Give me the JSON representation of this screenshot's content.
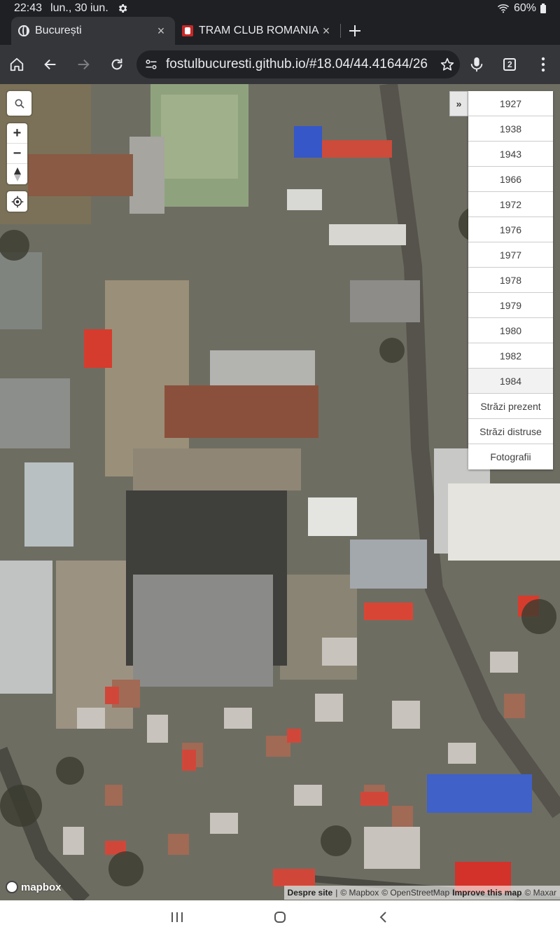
{
  "status": {
    "time": "22:43",
    "date": "lun., 30 iun.",
    "battery": "60%"
  },
  "tabs": [
    {
      "title": "București",
      "close": "×"
    },
    {
      "title": "TRAM CLUB ROMANIA ::",
      "close": "×"
    }
  ],
  "toolbar": {
    "url": "fostulbucuresti.github.io/#18.04/44.41644/26",
    "tab_count": "2"
  },
  "map": {
    "zoom_in": "+",
    "zoom_out": "−",
    "layer_toggle": "»",
    "layers": [
      "1927",
      "1938",
      "1943",
      "1966",
      "1972",
      "1976",
      "1977",
      "1978",
      "1979",
      "1980",
      "1982",
      "1984",
      "Străzi prezent",
      "Străzi distruse",
      "Fotografii"
    ],
    "selected_layer": "1984",
    "logo": "mapbox",
    "attribution": {
      "about": "Despre site",
      "sep": "|",
      "mapbox": "© Mapbox",
      "osm": "© OpenStreetMap",
      "improve": "Improve this map",
      "maxar": "© Maxar"
    }
  },
  "icons": {
    "home": "home-icon",
    "back": "back-arrow-icon",
    "forward": "forward-arrow-icon",
    "reload": "reload-icon",
    "mic": "mic-icon",
    "menu": "menu-icon"
  },
  "colors": {
    "browser_bg": "#35363a",
    "strip_bg": "#1f2023",
    "omnibox_bg": "#202124"
  }
}
